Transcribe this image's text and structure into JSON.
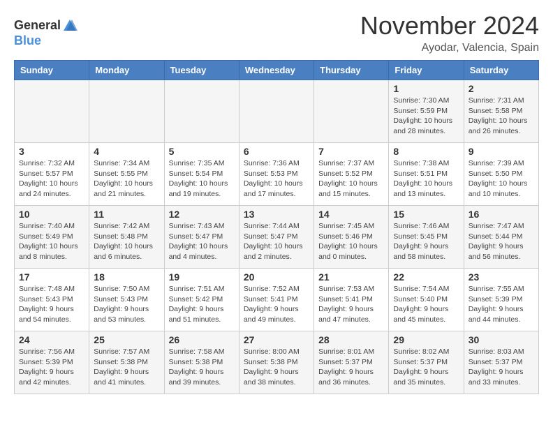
{
  "header": {
    "logo_general": "General",
    "logo_blue": "Blue",
    "month_title": "November 2024",
    "location": "Ayodar, Valencia, Spain"
  },
  "weekdays": [
    "Sunday",
    "Monday",
    "Tuesday",
    "Wednesday",
    "Thursday",
    "Friday",
    "Saturday"
  ],
  "weeks": [
    [
      {
        "day": "",
        "info": ""
      },
      {
        "day": "",
        "info": ""
      },
      {
        "day": "",
        "info": ""
      },
      {
        "day": "",
        "info": ""
      },
      {
        "day": "",
        "info": ""
      },
      {
        "day": "1",
        "info": "Sunrise: 7:30 AM\nSunset: 5:59 PM\nDaylight: 10 hours and 28 minutes."
      },
      {
        "day": "2",
        "info": "Sunrise: 7:31 AM\nSunset: 5:58 PM\nDaylight: 10 hours and 26 minutes."
      }
    ],
    [
      {
        "day": "3",
        "info": "Sunrise: 7:32 AM\nSunset: 5:57 PM\nDaylight: 10 hours and 24 minutes."
      },
      {
        "day": "4",
        "info": "Sunrise: 7:34 AM\nSunset: 5:55 PM\nDaylight: 10 hours and 21 minutes."
      },
      {
        "day": "5",
        "info": "Sunrise: 7:35 AM\nSunset: 5:54 PM\nDaylight: 10 hours and 19 minutes."
      },
      {
        "day": "6",
        "info": "Sunrise: 7:36 AM\nSunset: 5:53 PM\nDaylight: 10 hours and 17 minutes."
      },
      {
        "day": "7",
        "info": "Sunrise: 7:37 AM\nSunset: 5:52 PM\nDaylight: 10 hours and 15 minutes."
      },
      {
        "day": "8",
        "info": "Sunrise: 7:38 AM\nSunset: 5:51 PM\nDaylight: 10 hours and 13 minutes."
      },
      {
        "day": "9",
        "info": "Sunrise: 7:39 AM\nSunset: 5:50 PM\nDaylight: 10 hours and 10 minutes."
      }
    ],
    [
      {
        "day": "10",
        "info": "Sunrise: 7:40 AM\nSunset: 5:49 PM\nDaylight: 10 hours and 8 minutes."
      },
      {
        "day": "11",
        "info": "Sunrise: 7:42 AM\nSunset: 5:48 PM\nDaylight: 10 hours and 6 minutes."
      },
      {
        "day": "12",
        "info": "Sunrise: 7:43 AM\nSunset: 5:47 PM\nDaylight: 10 hours and 4 minutes."
      },
      {
        "day": "13",
        "info": "Sunrise: 7:44 AM\nSunset: 5:47 PM\nDaylight: 10 hours and 2 minutes."
      },
      {
        "day": "14",
        "info": "Sunrise: 7:45 AM\nSunset: 5:46 PM\nDaylight: 10 hours and 0 minutes."
      },
      {
        "day": "15",
        "info": "Sunrise: 7:46 AM\nSunset: 5:45 PM\nDaylight: 9 hours and 58 minutes."
      },
      {
        "day": "16",
        "info": "Sunrise: 7:47 AM\nSunset: 5:44 PM\nDaylight: 9 hours and 56 minutes."
      }
    ],
    [
      {
        "day": "17",
        "info": "Sunrise: 7:48 AM\nSunset: 5:43 PM\nDaylight: 9 hours and 54 minutes."
      },
      {
        "day": "18",
        "info": "Sunrise: 7:50 AM\nSunset: 5:43 PM\nDaylight: 9 hours and 53 minutes."
      },
      {
        "day": "19",
        "info": "Sunrise: 7:51 AM\nSunset: 5:42 PM\nDaylight: 9 hours and 51 minutes."
      },
      {
        "day": "20",
        "info": "Sunrise: 7:52 AM\nSunset: 5:41 PM\nDaylight: 9 hours and 49 minutes."
      },
      {
        "day": "21",
        "info": "Sunrise: 7:53 AM\nSunset: 5:41 PM\nDaylight: 9 hours and 47 minutes."
      },
      {
        "day": "22",
        "info": "Sunrise: 7:54 AM\nSunset: 5:40 PM\nDaylight: 9 hours and 45 minutes."
      },
      {
        "day": "23",
        "info": "Sunrise: 7:55 AM\nSunset: 5:39 PM\nDaylight: 9 hours and 44 minutes."
      }
    ],
    [
      {
        "day": "24",
        "info": "Sunrise: 7:56 AM\nSunset: 5:39 PM\nDaylight: 9 hours and 42 minutes."
      },
      {
        "day": "25",
        "info": "Sunrise: 7:57 AM\nSunset: 5:38 PM\nDaylight: 9 hours and 41 minutes."
      },
      {
        "day": "26",
        "info": "Sunrise: 7:58 AM\nSunset: 5:38 PM\nDaylight: 9 hours and 39 minutes."
      },
      {
        "day": "27",
        "info": "Sunrise: 8:00 AM\nSunset: 5:38 PM\nDaylight: 9 hours and 38 minutes."
      },
      {
        "day": "28",
        "info": "Sunrise: 8:01 AM\nSunset: 5:37 PM\nDaylight: 9 hours and 36 minutes."
      },
      {
        "day": "29",
        "info": "Sunrise: 8:02 AM\nSunset: 5:37 PM\nDaylight: 9 hours and 35 minutes."
      },
      {
        "day": "30",
        "info": "Sunrise: 8:03 AM\nSunset: 5:37 PM\nDaylight: 9 hours and 33 minutes."
      }
    ]
  ]
}
